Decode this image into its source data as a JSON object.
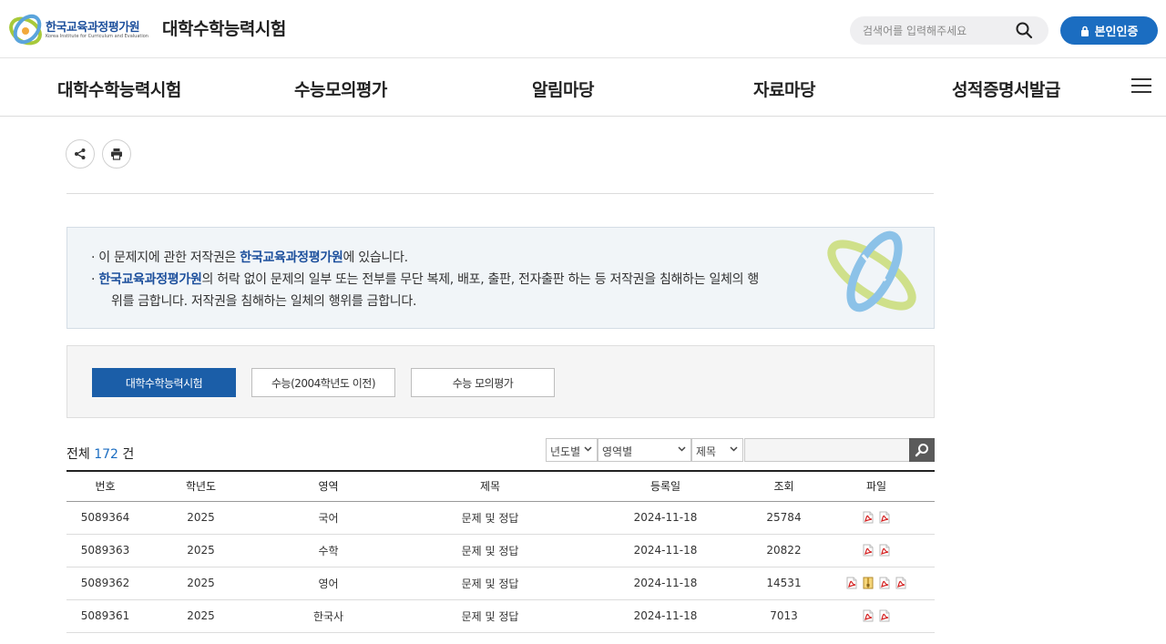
{
  "header": {
    "logo_text": "한국교육과정평가원",
    "logo_subtext": "Korea Institute for Curriculum and Evaluation",
    "site_title": "대학수학능력시험",
    "search_placeholder": "검색어를 입력해주세요",
    "auth_button": "본인인증",
    "accent_color": "#1b6dc1"
  },
  "nav": {
    "items": [
      {
        "label": "대학수학능력시험"
      },
      {
        "label": "수능모의평가"
      },
      {
        "label": "알림마당"
      },
      {
        "label": "자료마당"
      },
      {
        "label": "성적증명서발급"
      }
    ]
  },
  "notice": {
    "line1_prefix": "· 이 문제지에 관한 저작권은 ",
    "line1_org": "한국교육과정평가원",
    "line1_suffix": "에 있습니다.",
    "line2_prefix": "· ",
    "line2_org": "한국교육과정평가원",
    "line2_suffix": "의 허락 없이 문제의 일부 또는 전부를 무단 복제, 배포, 출판, 전자출판 하는 등 저작권을 침해하는 일체의 행",
    "line3": "위를 금합니다. 저작권을 침해하는 일체의 행위를 금합니다."
  },
  "tabs": [
    {
      "label": "대학수학능력시험",
      "active": true
    },
    {
      "label": "수능(2004학년도 이전)",
      "active": false
    },
    {
      "label": "수능 모의평가",
      "active": false
    }
  ],
  "list": {
    "total_prefix": "전체",
    "total_count": "172",
    "total_suffix": "건"
  },
  "filters": {
    "year": "년도별",
    "area": "영역별",
    "field": "제목",
    "keyword": ""
  },
  "table": {
    "headers": [
      "번호",
      "학년도",
      "영역",
      "제목",
      "등록일",
      "조회",
      "파일"
    ],
    "rows": [
      {
        "no": "5089364",
        "year": "2025",
        "area": "국어",
        "title": "문제 및 정답",
        "date": "2024-11-18",
        "views": "25784",
        "files": [
          "pdf-icon",
          "pdf-icon"
        ]
      },
      {
        "no": "5089363",
        "year": "2025",
        "area": "수학",
        "title": "문제 및 정답",
        "date": "2024-11-18",
        "views": "20822",
        "files": [
          "pdf-icon",
          "pdf-icon"
        ]
      },
      {
        "no": "5089362",
        "year": "2025",
        "area": "영어",
        "title": "문제 및 정답",
        "date": "2024-11-18",
        "views": "14531",
        "files": [
          "pdf-icon",
          "zip-icon",
          "pdf-icon",
          "pdf-icon"
        ]
      },
      {
        "no": "5089361",
        "year": "2025",
        "area": "한국사",
        "title": "문제 및 정답",
        "date": "2024-11-18",
        "views": "7013",
        "files": [
          "pdf-icon",
          "pdf-icon"
        ]
      }
    ]
  }
}
